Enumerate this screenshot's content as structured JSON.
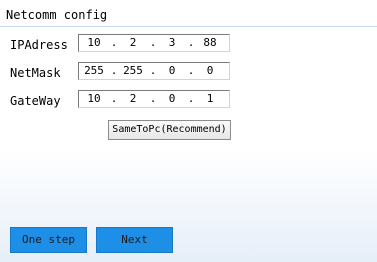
{
  "window": {
    "section_title": "Netcomm config"
  },
  "fields": [
    {
      "label": "IPAdress",
      "octets": [
        "10",
        "2",
        "3",
        "88"
      ]
    },
    {
      "label": "NetMask",
      "octets": [
        "255",
        "255",
        "0",
        "0"
      ]
    },
    {
      "label": "GateWay",
      "octets": [
        "10",
        "2",
        "0",
        "1"
      ]
    }
  ],
  "separator": ".",
  "buttons": {
    "same_to_pc": "SameToPc(Recommend)",
    "one_step": "One step",
    "next": "Next"
  },
  "colors": {
    "nav_button": "#1d8fe6",
    "title_rule": "#c8d8f0"
  }
}
